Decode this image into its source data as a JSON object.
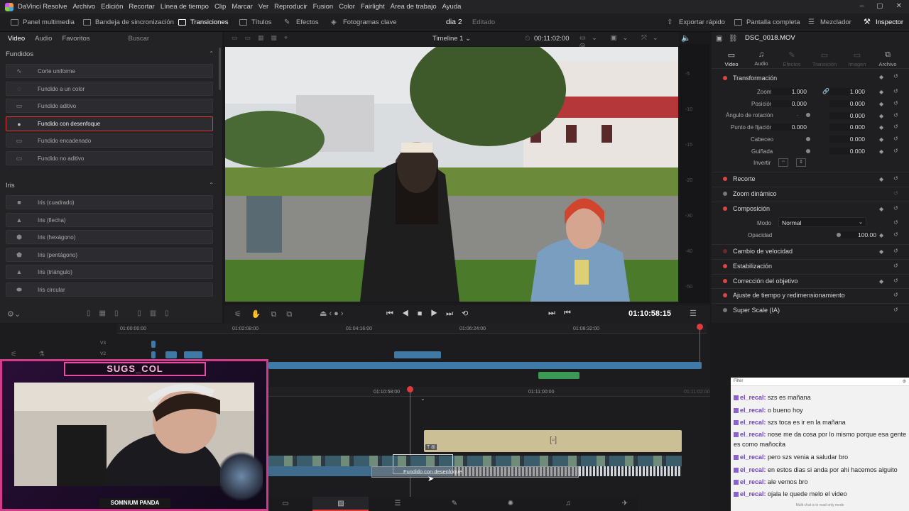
{
  "menu": [
    "DaVinci Resolve",
    "Archivo",
    "Edición",
    "Recortar",
    "Línea de tiempo",
    "Clip",
    "Marcar",
    "Ver",
    "Reproducir",
    "Fusion",
    "Color",
    "Fairlight",
    "Área de trabajo",
    "Ayuda"
  ],
  "toolbar": {
    "media_pool": "Panel multimedia",
    "sync_bin": "Bandeja de sincronización",
    "transitions": "Transiciones",
    "titles": "Títulos",
    "effects": "Efectos",
    "keyframes": "Fotogramas clave",
    "project_name": "dia 2",
    "project_status": "Editado",
    "quick_export": "Exportar rápido",
    "fullscreen": "Pantalla completa",
    "mixer": "Mezclador",
    "inspector": "Inspector"
  },
  "effects_panel": {
    "tabs": [
      "Video",
      "Audio",
      "Favoritos"
    ],
    "search_placeholder": "Buscar",
    "section_fundidos": "Fundidos",
    "fundidos": [
      {
        "label": "Corte uniforme",
        "glyph": "∿",
        "selected": false
      },
      {
        "label": "Fundido a un color",
        "glyph": "◌",
        "selected": false
      },
      {
        "label": "Fundido aditivo",
        "glyph": "▭",
        "selected": false
      },
      {
        "label": "Fundido con desenfoque",
        "glyph": "💧",
        "selected": true
      },
      {
        "label": "Fundido encadenado",
        "glyph": "▭",
        "selected": false
      },
      {
        "label": "Fundido no aditivo",
        "glyph": "▭",
        "selected": false
      }
    ],
    "section_iris": "Iris",
    "iris": [
      {
        "label": "Iris (cuadrado)",
        "glyph": "■"
      },
      {
        "label": "Iris (flecha)",
        "glyph": "▲"
      },
      {
        "label": "Iris (hexágono)",
        "glyph": "⬢"
      },
      {
        "label": "Iris (pentágono)",
        "glyph": "⬟"
      },
      {
        "label": "Iris (triángulo)",
        "glyph": "▲"
      },
      {
        "label": "Iris circular",
        "glyph": "⬬"
      }
    ]
  },
  "viewer": {
    "timeline_name": "Timeline 1",
    "timecode_top": "00:11:02:00",
    "timecode": "01:10:58:15"
  },
  "inspector": {
    "clip_name": "DSC_0018.MOV",
    "tabs": [
      "Video",
      "Audio",
      "Efectos",
      "Transición",
      "Imagen",
      "Archivo"
    ],
    "transform": {
      "title": "Transformación",
      "zoom_label": "Zoom",
      "zoom_x": "1.000",
      "zoom_y": "1.000",
      "position_label": "Posición",
      "pos_x": "0.000",
      "pos_y": "0.000",
      "rotation_label": "Ángulo de rotación",
      "rotation": "0.000",
      "anchor_label": "Punto de fijación",
      "anchor_x": "0.000",
      "anchor_y": "0.000",
      "pitch_label": "Cabeceo",
      "pitch": "0.000",
      "yaw_label": "Guiñada",
      "yaw": "0.000",
      "flip_label": "Invertir",
      "x": "X",
      "y": "Y"
    },
    "sections": [
      "Recorte",
      "Zoom dinámico",
      "Composición"
    ],
    "composite": {
      "mode_label": "Modo",
      "mode": "Normal",
      "opacity_label": "Opacidad",
      "opacity": "100.00"
    },
    "more_sections": [
      "Cambio de velocidad",
      "Estabilización",
      "Corrección del objetivo",
      "Ajuste de tiempo y redimensionamiento",
      "Super Scale (IA)"
    ]
  },
  "timeline": {
    "ruler_top": [
      "01:00:00:00",
      "01:02:08:00",
      "01:04:16:00",
      "01:06:24:00",
      "01:08:32:00"
    ],
    "tracks": [
      "V3",
      "V2"
    ],
    "ruler_bottom": [
      "01:10:58:00",
      "01:11:00:00",
      "01:11:02:00"
    ],
    "drag_label": "Fundido con desenfoque"
  },
  "chat": {
    "header": "Filter",
    "messages": [
      {
        "user": "el_recal:",
        "text": "szs es mañana"
      },
      {
        "user": "el_recal:",
        "text": "o bueno hoy"
      },
      {
        "user": "el_recal:",
        "text": "szs toca es ir en la mañana"
      },
      {
        "user": "el_recal:",
        "text": "nose me da cosa por lo mismo porque esa gente es como mañocita"
      },
      {
        "user": "el_recal:",
        "text": "pero szs venia a saludar bro"
      },
      {
        "user": "el_recal:",
        "text": "en estos dias si anda por ahi hacemos alguito"
      },
      {
        "user": "el_recal:",
        "text": "ale vemos bro"
      },
      {
        "user": "el_recal:",
        "text": "ojala le quede melo el video"
      }
    ],
    "footer": "Multi chat is in read-only mode"
  },
  "stream": {
    "channel": "SUGS_COL",
    "brand": "SOMNIUM PANDA"
  },
  "colors": {
    "accent_red": "#e03a3a",
    "clip_blue": "#3e79a8",
    "audio_green": "#3a9a55",
    "title_clip": "#cbbf96"
  }
}
